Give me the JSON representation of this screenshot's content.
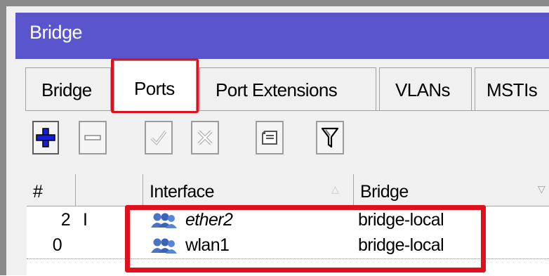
{
  "window": {
    "title": "Bridge"
  },
  "tabs": [
    {
      "label": "Bridge",
      "active": false
    },
    {
      "label": "Ports",
      "active": true,
      "highlighted": true
    },
    {
      "label": "Port Extensions",
      "active": false
    },
    {
      "label": "VLANs",
      "active": false
    },
    {
      "label": "MSTIs",
      "active": false
    }
  ],
  "toolbar": {
    "buttons": [
      {
        "icon": "plus-icon",
        "enabled": true
      },
      {
        "icon": "minus-icon",
        "enabled": true
      },
      {
        "icon": "check-icon",
        "enabled": false
      },
      {
        "icon": "cross-icon",
        "enabled": false
      },
      {
        "icon": "comment-icon",
        "enabled": true
      },
      {
        "icon": "filter-icon",
        "enabled": true
      }
    ]
  },
  "table": {
    "columns": [
      "#",
      "",
      "Interface",
      "Bridge"
    ],
    "rows": [
      {
        "num": "2",
        "flag": "I",
        "interface": "ether2",
        "interface_italic": true,
        "bridge": "bridge-local"
      },
      {
        "num": "0",
        "flag": "",
        "interface": "wlan1",
        "interface_italic": false,
        "bridge": "bridge-local"
      }
    ]
  },
  "colors": {
    "titlebar": "#5a55cc",
    "highlight": "#e0101c",
    "plus_icon": "#1420d8"
  }
}
